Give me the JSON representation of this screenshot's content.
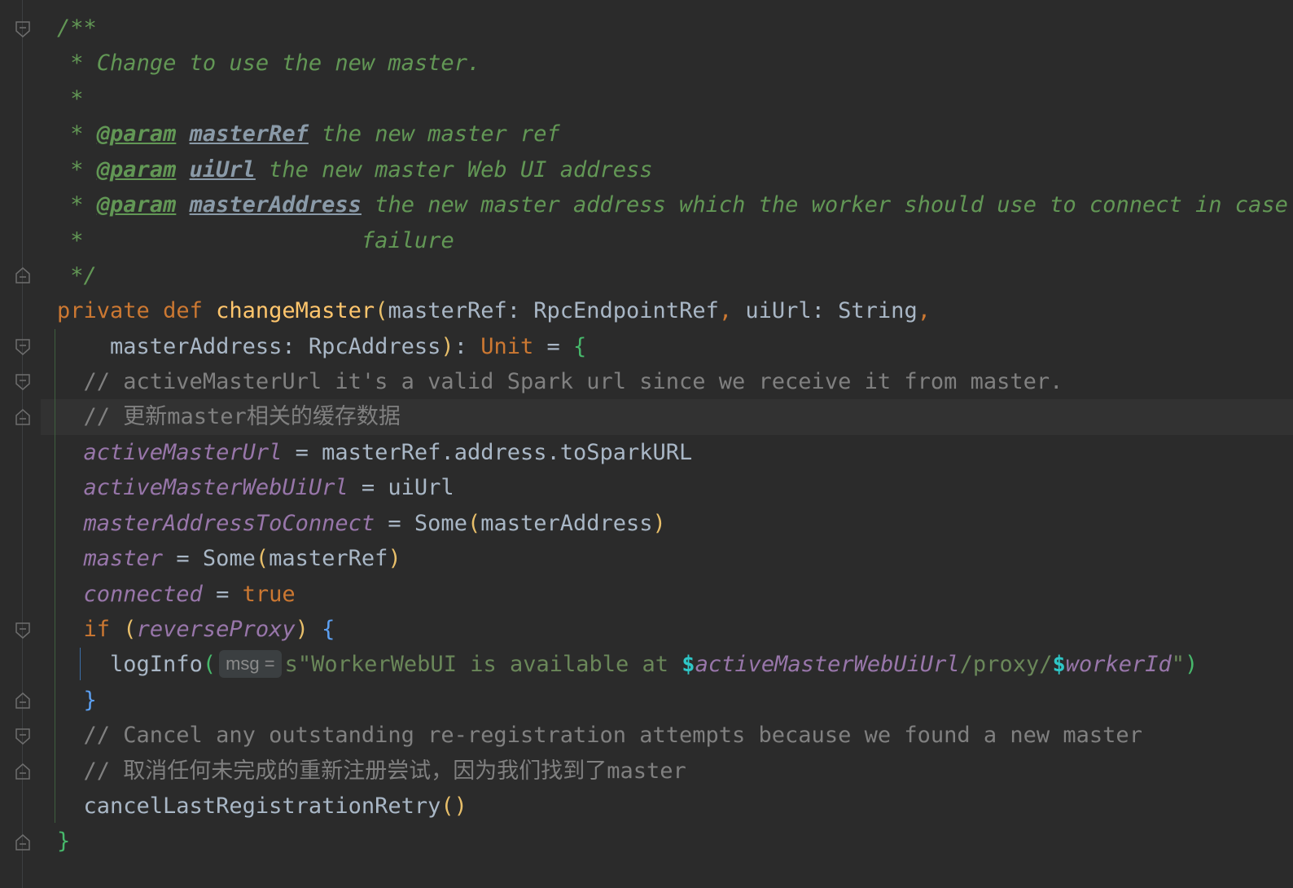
{
  "doc": {
    "open": "/**",
    "desc": "Change to use the new master.",
    "star": "*",
    "param_tag": "@param",
    "p1_name": "masterRef",
    "p1_desc": "the new master ref",
    "p2_name": "uiUrl",
    "p2_desc": "the new master Web UI address",
    "p3_name": "masterAddress",
    "p3_desc": "the new master address which the worker should use to connect in case of",
    "p3_cont": "failure",
    "close": "*/"
  },
  "code": {
    "private": "private",
    "def": "def",
    "fname": "changeMaster",
    "sig1_a": "masterRef: RpcEndpointRef",
    "sig1_b": "uiUrl: String",
    "sig2_a": "masterAddress: RpcAddress",
    "unit": "Unit",
    "eq": " = ",
    "comment1": "// activeMasterUrl it's a valid Spark url since we receive it from master.",
    "comment2": "// 更新master相关的缓存数据",
    "f_activeMasterUrl": "activeMasterUrl",
    "v_activeMasterUrl": "masterRef.address.toSparkURL",
    "f_activeMasterWebUiUrl": "activeMasterWebUiUrl",
    "v_activeMasterWebUiUrl": "uiUrl",
    "f_masterAddressToConnect": "masterAddressToConnect",
    "v_some1": "Some",
    "v_masterAddress": "masterAddress",
    "f_master": "master",
    "v_masterRef": "masterRef",
    "f_connected": "connected",
    "v_true": "true",
    "kw_if": "if",
    "f_reverseProxy": "reverseProxy",
    "logInfo": "logInfo",
    "hint_msg": "msg =",
    "str_a": "s\"WorkerWebUI is available at ",
    "interp1_dollar": "$",
    "interp1": "activeMasterWebUiUrl",
    "str_b": "/proxy/",
    "interp2_dollar": "$",
    "interp2": "workerId",
    "str_c": "\"",
    "comment3": "// Cancel any outstanding re-registration attempts because we found a new master",
    "comment4": "// 取消任何未完成的重新注册尝试，因为我们找到了master",
    "cancel_call": "cancelLastRegistrationRetry",
    "paren_empty": "()"
  },
  "colors": {
    "background": "#2b2b2b",
    "doc_comment": "#629755",
    "keyword": "#cc7832",
    "function": "#ffc66d",
    "field": "#9876aa",
    "line_comment": "#808080",
    "string": "#6a8759",
    "default_text": "#a9b7c6"
  }
}
